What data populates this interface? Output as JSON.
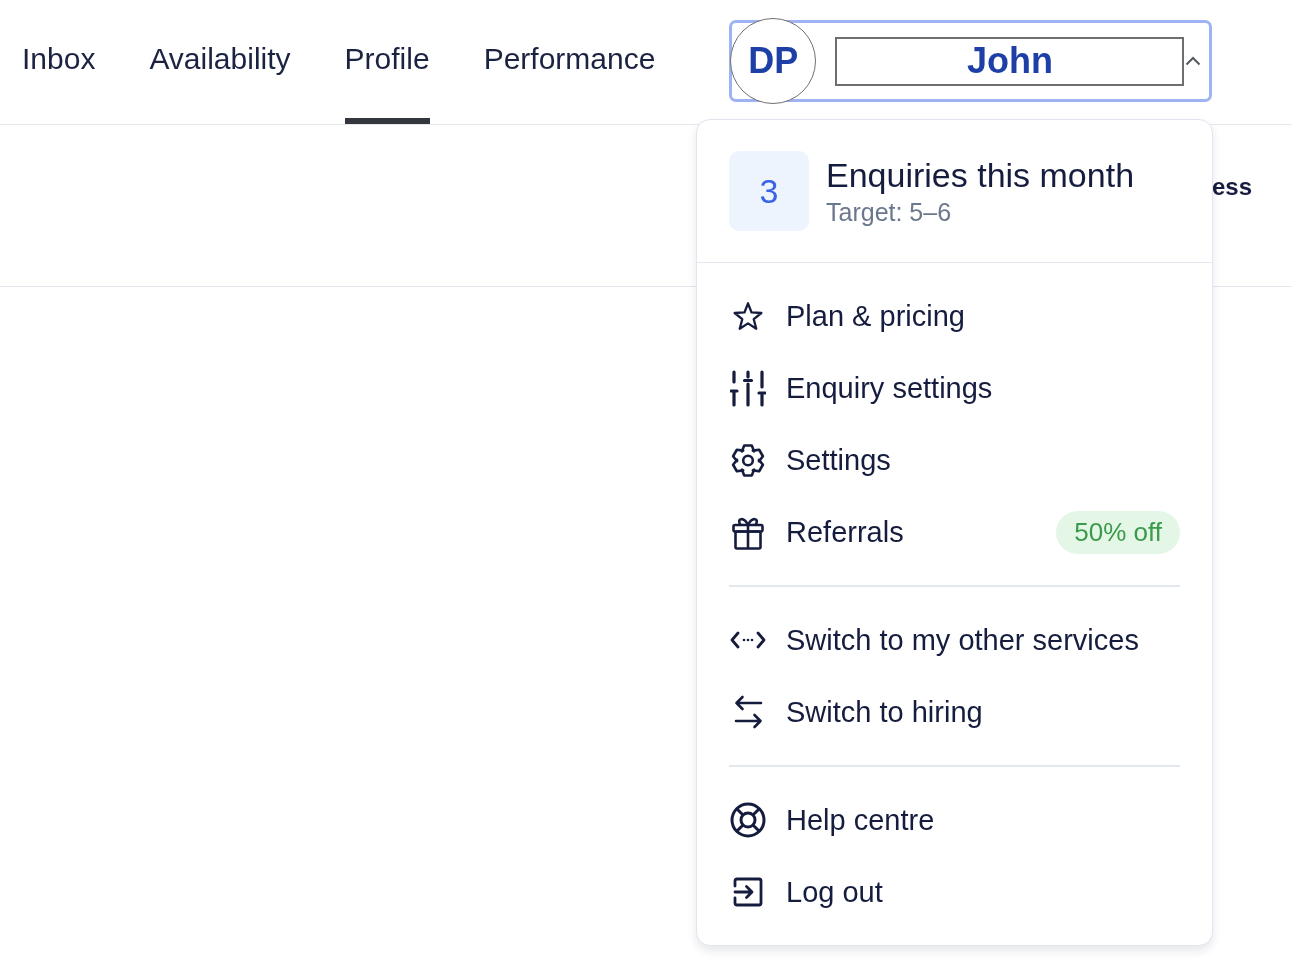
{
  "nav": {
    "tabs": [
      {
        "label": "Inbox",
        "selected": false
      },
      {
        "label": "Availability",
        "selected": false
      },
      {
        "label": "Profile",
        "selected": true
      },
      {
        "label": "Performance",
        "selected": false
      }
    ]
  },
  "account": {
    "initials": "DP",
    "name": "John",
    "expanded": true
  },
  "sub_header": {
    "label": "ess"
  },
  "dropdown": {
    "stat": {
      "value": "3",
      "label": "Enquiries this month",
      "target": "Target: 5–6"
    },
    "sections": [
      {
        "items": [
          {
            "label": "Plan & pricing"
          },
          {
            "label": "Enquiry settings"
          },
          {
            "label": "Settings"
          },
          {
            "label": "Referrals",
            "badge": "50% off"
          }
        ]
      },
      {
        "items": [
          {
            "label": "Switch to my other services"
          },
          {
            "label": "Switch to hiring"
          }
        ]
      },
      {
        "items": [
          {
            "label": "Help centre"
          },
          {
            "label": "Log out"
          }
        ]
      }
    ]
  }
}
